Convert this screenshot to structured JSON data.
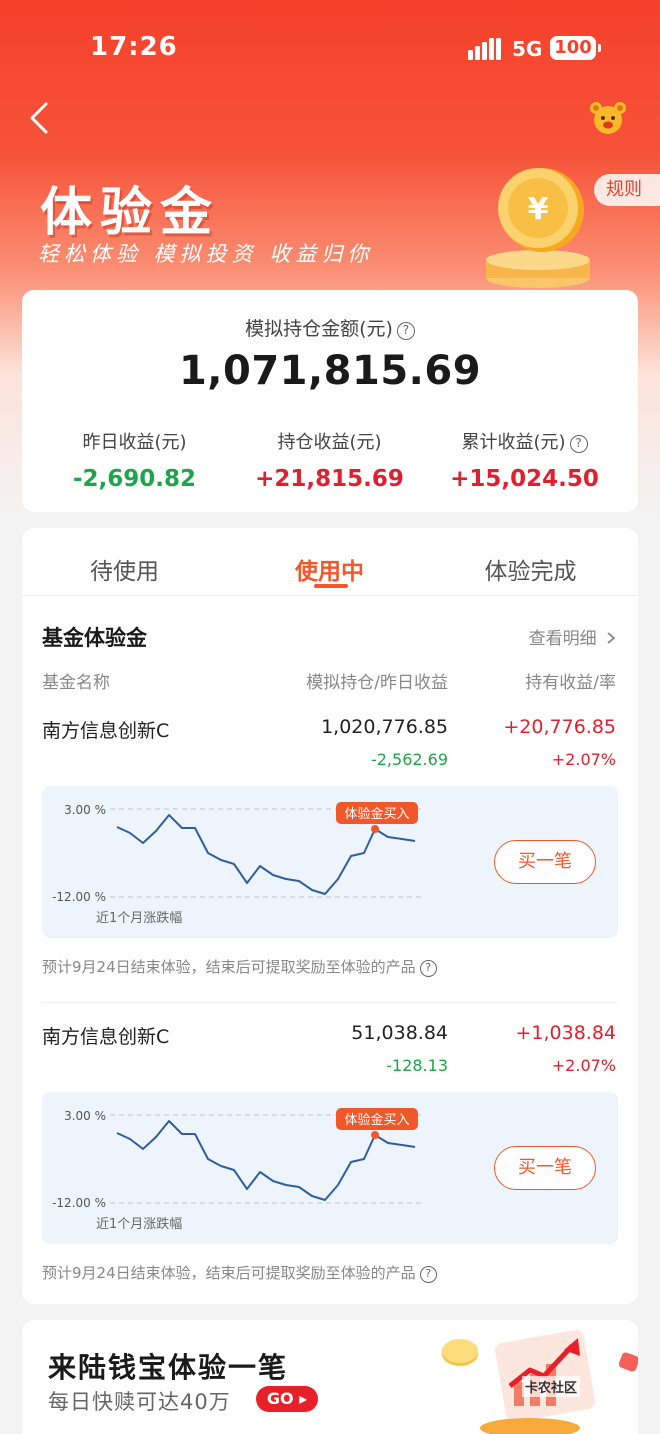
{
  "status_bar": {
    "time": "17:26",
    "network": "5G",
    "battery": "100"
  },
  "header": {
    "title": "体验金",
    "subtitle": "轻松体验 模拟投资 收益归你",
    "rules_label": "规则"
  },
  "summary": {
    "label": "模拟持仓金额(元)",
    "total": "1,071,815.69",
    "stats": [
      {
        "label": "昨日收益(元)",
        "value": "-2,690.82"
      },
      {
        "label": "持仓收益(元)",
        "value": "+21,815.69"
      },
      {
        "label": "累计收益(元)",
        "value": "+15,024.50"
      }
    ]
  },
  "tabs": [
    {
      "label": "待使用"
    },
    {
      "label": "使用中"
    },
    {
      "label": "体验完成"
    }
  ],
  "section": {
    "title": "基金体验金",
    "detail_link": "查看明细",
    "col_name": "基金名称",
    "col_position": "模拟持仓/昨日收益",
    "col_return": "持有收益/率"
  },
  "funds": [
    {
      "name": "南方信息创新C",
      "position": "1,020,776.85",
      "yesterday": "-2,562.69",
      "holding_return": "+20,776.85",
      "rate": "+2.07%",
      "chart": {
        "y_top": "3.00 %",
        "y_bottom": "-12.00 %",
        "caption": "近1个月涨跌幅",
        "tag": "体验金买入"
      },
      "buy_label": "买一笔",
      "note": "预计9月24日结束体验，结束后可提取奖励至体验的产品"
    },
    {
      "name": "南方信息创新C",
      "position": "51,038.84",
      "yesterday": "-128.13",
      "holding_return": "+1,038.84",
      "rate": "+2.07%",
      "chart": {
        "y_top": "3.00 %",
        "y_bottom": "-12.00 %",
        "caption": "近1个月涨跌幅",
        "tag": "体验金买入"
      },
      "buy_label": "买一笔",
      "note": "预计9月24日结束体验，结束后可提取奖励至体验的产品"
    }
  ],
  "promo": {
    "title": "来陆钱宝体验一笔",
    "subtitle": "每日快赎可达40万",
    "go_label": "GO"
  },
  "watermark": "卡农社区",
  "icons": {
    "back": "chevron-left-icon",
    "mascot": "mascot-icon",
    "help": "question-circle-icon",
    "detail": "chevron-right-icon"
  },
  "colors": {
    "brand": "#f5402a",
    "accent": "#f0582a",
    "up": "#e0202f",
    "down": "#1da54a",
    "line": "#2f5f9e"
  }
}
